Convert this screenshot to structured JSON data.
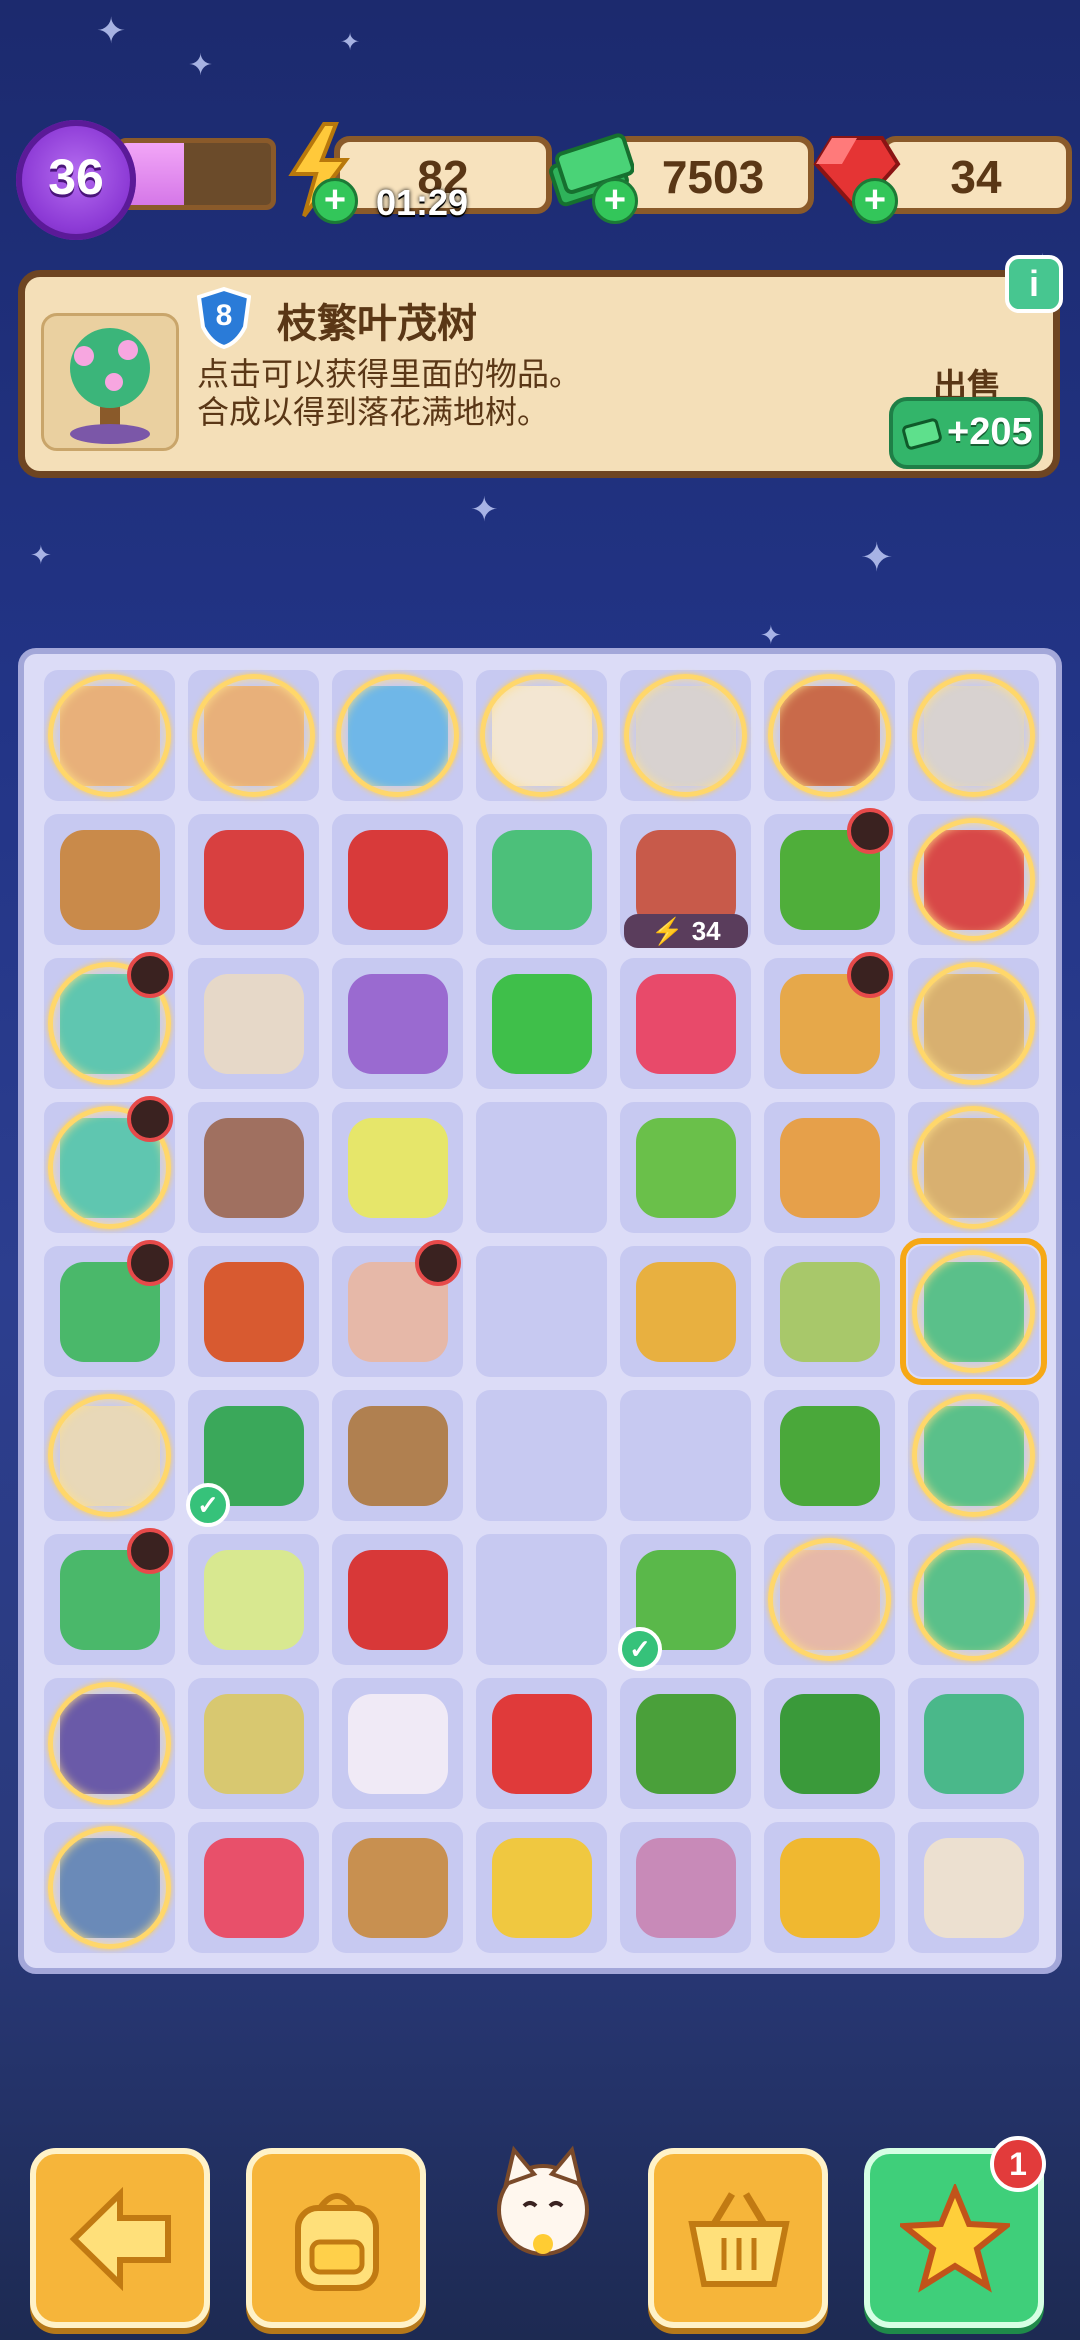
{
  "hud": {
    "level": "36",
    "xp_progress": 0.42,
    "energy": "82",
    "energy_timer": "01:29",
    "cash": "7503",
    "gems": "34"
  },
  "info_panel": {
    "item_level": "8",
    "item_name": "枝繁叶茂树",
    "item_description": "点击可以获得里面的物品。\n合成以得到落花满地树。",
    "sell_label": "出售",
    "sell_amount": "+205",
    "info_button": "i"
  },
  "board": {
    "tv_cost": "34",
    "rows": [
      [
        "bread-bubble",
        "bread-bubble",
        "cards-bubble",
        "envelope-bubble",
        "machine-bubble",
        "toolbox-bubble",
        "machine-bubble"
      ],
      [
        "crate",
        "pliers",
        "red-toolbox",
        "cleaning-bucket",
        "tv",
        "flower-pot",
        "bag-bubble"
      ],
      [
        "clothes-bubble",
        "bag-of-goods",
        "moth",
        "green-rag",
        "feather-mask",
        "vase",
        "cake-bubble"
      ],
      [
        "clothes-bubble",
        "sugar-cubes",
        "lotion-bottle",
        "empty",
        "sprout-pot",
        "magnifier",
        "cake-bubble"
      ],
      [
        "folders",
        "coin-pouch",
        "jar",
        "empty",
        "seeds",
        "sponge",
        "tree-bubble-selected"
      ],
      [
        "map-bubble",
        "brush",
        "yak",
        "empty",
        "empty",
        "plant-pot",
        "tree-bubble"
      ],
      [
        "folders",
        "detergent",
        "ladybug-shell",
        "empty",
        "vacuum",
        "jar-bubble",
        "tree-bubble"
      ],
      [
        "gear-bubble",
        "seed-sack",
        "crystal-ball",
        "ladybug",
        "flower-bush",
        "berry-bush",
        "bonsai"
      ],
      [
        "photo-bubble",
        "flower-basket",
        "coin-purse",
        "barrier",
        "beans",
        "cheese",
        "seed-packet"
      ]
    ]
  },
  "bottom_bar": {
    "notification_count": "1"
  }
}
